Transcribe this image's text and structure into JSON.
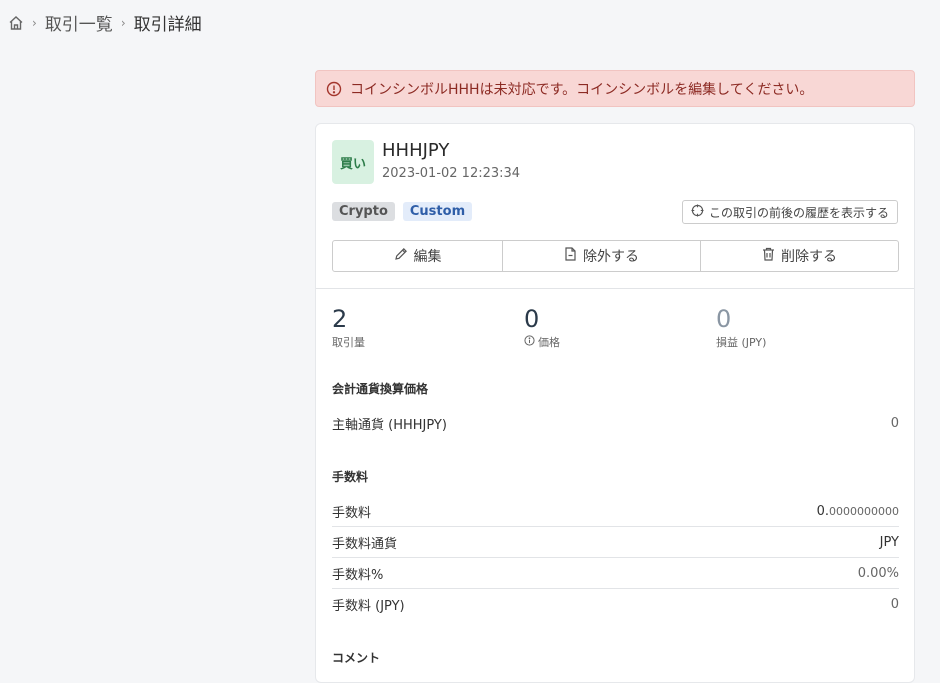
{
  "breadcrumb": {
    "items": [
      "取引一覧",
      "取引詳細"
    ],
    "separator": "›"
  },
  "alert": {
    "message": "コインシンボルHHHは未対応です。コインシンボルを編集してください。"
  },
  "trade": {
    "side": "買い",
    "symbol": "HHHJPY",
    "datetime": "2023-01-02 12:23:34",
    "tags": [
      "Crypto",
      "Custom"
    ],
    "history_button": "この取引の前後の履歴を表示する"
  },
  "actions": {
    "edit": "編集",
    "exclude": "除外する",
    "delete": "削除する"
  },
  "stats": [
    {
      "value": "2",
      "label": "取引量"
    },
    {
      "value": "0",
      "label": "価格"
    },
    {
      "value": "0",
      "label": "損益 (JPY)"
    }
  ],
  "conversion": {
    "title": "会計通貨換算価格",
    "label": "主軸通貨 (HHHJPY)",
    "value": "0"
  },
  "fees": {
    "title": "手数料",
    "rows": [
      {
        "label": "手数料",
        "value_main": "0.",
        "value_small": "0000000000"
      },
      {
        "label": "手数料通貨",
        "value": "JPY"
      },
      {
        "label": "手数料%",
        "value": "0.00%"
      },
      {
        "label": "手数料 (JPY)",
        "value": "0"
      }
    ]
  },
  "comment": {
    "title": "コメント"
  }
}
